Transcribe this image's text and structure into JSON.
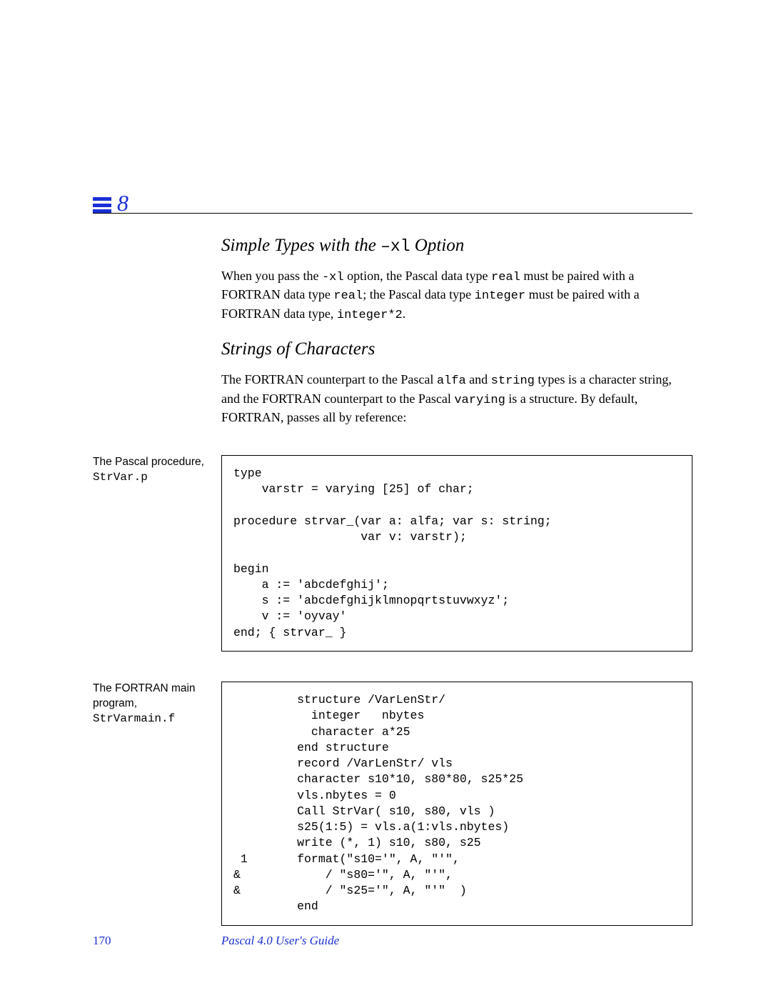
{
  "chapter_number": "8",
  "section1": {
    "title_pre": "Simple Types with the ",
    "title_code": "–xl",
    "title_post": " Option",
    "para_parts": [
      {
        "t": "When you pass the "
      },
      {
        "t": "-xl",
        "mono": true
      },
      {
        "t": " option, the Pascal data type "
      },
      {
        "t": "real",
        "mono": true
      },
      {
        "t": " must be paired with a FORTRAN data type "
      },
      {
        "t": "real",
        "mono": true
      },
      {
        "t": "; the Pascal data type "
      },
      {
        "t": "integer",
        "mono": true
      },
      {
        "t": " must be paired with a FORTRAN data type, "
      },
      {
        "t": "integer*2",
        "mono": true
      },
      {
        "t": "."
      }
    ]
  },
  "section2": {
    "title": "Strings of Characters",
    "para_parts": [
      {
        "t": "The FORTRAN counterpart to the Pascal "
      },
      {
        "t": "alfa",
        "mono": true
      },
      {
        "t": " and "
      },
      {
        "t": "string",
        "mono": true
      },
      {
        "t": " types is a character string, and the FORTRAN counterpart to the Pascal "
      },
      {
        "t": "varying",
        "mono": true
      },
      {
        "t": " is a structure.  By default, FORTRAN, passes all by reference:"
      }
    ]
  },
  "block1": {
    "caption_plain": "The Pascal procedure,",
    "caption_mono": "StrVar.p",
    "code": "type\n    varstr = varying [25] of char;\n\nprocedure strvar_(var a: alfa; var s: string;\n                  var v: varstr);\n\nbegin\n    a := 'abcdefghij';\n    s := 'abcdefghijklmnopqrtstuvwxyz';\n    v := 'oyvay'\nend; { strvar_ }"
  },
  "block2": {
    "caption_plain": "The FORTRAN main program,",
    "caption_mono": "StrVarmain.f",
    "code": "         structure /VarLenStr/\n           integer   nbytes\n           character a*25\n         end structure\n         record /VarLenStr/ vls\n         character s10*10, s80*80, s25*25\n         vls.nbytes = 0\n         Call StrVar( s10, s80, vls )\n         s25(1:5) = vls.a(1:vls.nbytes)\n         write (*, 1) s10, s80, s25\n 1       format(\"s10='\", A, \"'\",\n&            / \"s80='\", A, \"'\",\n&            / \"s25='\", A, \"'\"  )\n         end"
  },
  "footer": {
    "page_number": "170",
    "book_title": "Pascal 4.0 User's Guide"
  }
}
